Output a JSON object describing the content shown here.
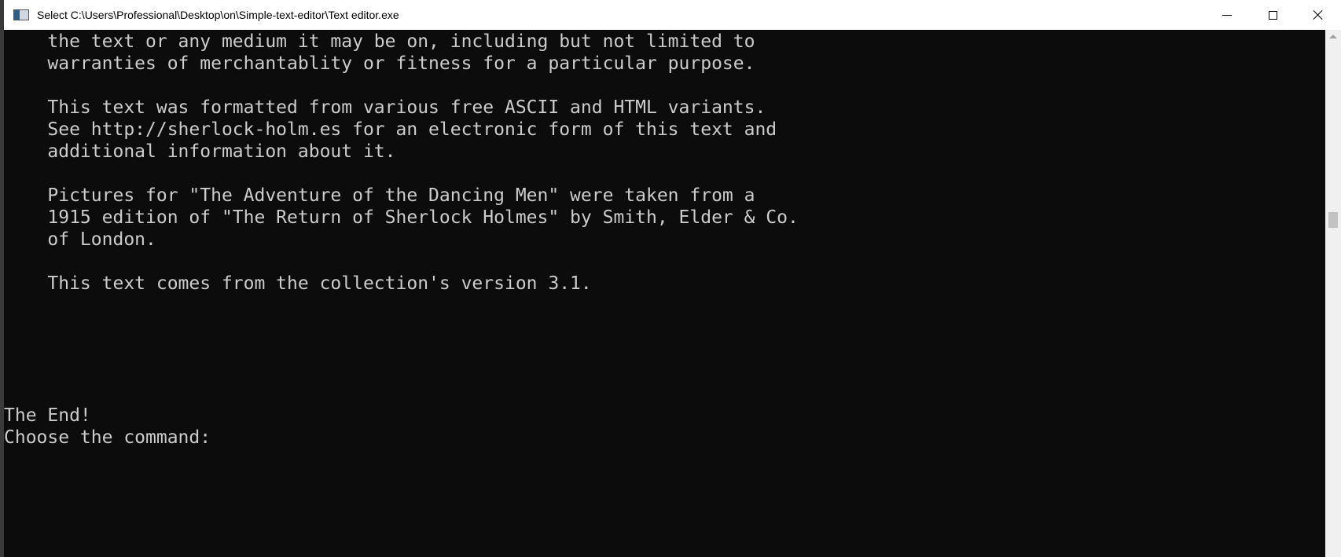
{
  "window": {
    "title": "Select C:\\Users\\Professional\\Desktop\\on\\Simple-text-editor\\Text editor.exe"
  },
  "console": {
    "lines": [
      "    the text or any medium it may be on, including but not limited to",
      "    warranties of merchantablity or fitness for a particular purpose.",
      "",
      "    This text was formatted from various free ASCII and HTML variants.",
      "    See http://sherlock-holm.es for an electronic form of this text and",
      "    additional information about it.",
      "",
      "    Pictures for \"The Adventure of the Dancing Men\" were taken from a",
      "    1915 edition of \"The Return of Sherlock Holmes\" by Smith, Elder & Co.",
      "    of London.",
      "",
      "    This text comes from the collection's version 3.1.",
      "",
      "",
      "",
      "",
      "",
      "The End!",
      "Choose the command:"
    ]
  },
  "colors": {
    "console_bg": "#0c0c0c",
    "console_fg": "#cccccc",
    "titlebar_bg": "#ffffff"
  }
}
